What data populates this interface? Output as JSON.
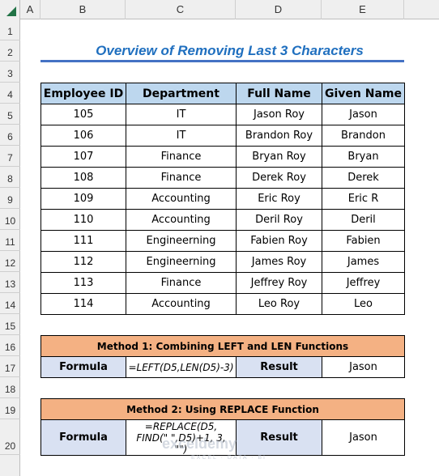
{
  "sheet": {
    "columns": [
      "A",
      "B",
      "C",
      "D",
      "E"
    ],
    "rows": [
      "1",
      "2",
      "3",
      "4",
      "5",
      "6",
      "7",
      "8",
      "9",
      "10",
      "11",
      "12",
      "13",
      "14",
      "15",
      "16",
      "17",
      "18",
      "19",
      "20"
    ]
  },
  "title": "Overview of Removing Last 3 Characters",
  "table": {
    "headers": [
      "Employee ID",
      "Department",
      "Full Name",
      "Given Name"
    ],
    "rows": [
      [
        "105",
        "IT",
        "Jason Roy",
        "Jason"
      ],
      [
        "106",
        "IT",
        "Brandon Roy",
        "Brandon"
      ],
      [
        "107",
        "Finance",
        "Bryan Roy",
        "Bryan"
      ],
      [
        "108",
        "Finance",
        "Derek Roy",
        "Derek"
      ],
      [
        "109",
        "Accounting",
        "Eric Roy",
        "Eric R"
      ],
      [
        "110",
        "Accounting",
        "Deril Roy",
        "Deril"
      ],
      [
        "111",
        "Engineerning",
        "Fabien Roy",
        "Fabien"
      ],
      [
        "112",
        "Engineerning",
        "James Roy",
        "James"
      ],
      [
        "113",
        "Finance",
        "Jeffrey Roy",
        "Jeffrey"
      ],
      [
        "114",
        "Accounting",
        "Leo Roy",
        "Leo"
      ]
    ]
  },
  "methods": [
    {
      "title": "Method 1:  Combining LEFT and LEN Functions",
      "formula_label": "Formula",
      "formula": "=LEFT(D5,LEN(D5)-3)",
      "result_label": "Result",
      "result": "Jason"
    },
    {
      "title": "Method 2:  Using REPLACE Function",
      "formula_label": "Formula",
      "formula": "=REPLACE(D5, FIND(\" \",D5)+1, 3, \"\")",
      "result_label": "Result",
      "result": "Jason"
    }
  ],
  "watermark": {
    "brand": "exceldemy",
    "tagline": "EXCEL · DATA · BI"
  },
  "colors": {
    "title": "#1f6fbf",
    "header_fill": "#bdd7ee",
    "method_fill": "#f4b183",
    "label_fill": "#d9e1f2",
    "excel_green": "#217346"
  }
}
